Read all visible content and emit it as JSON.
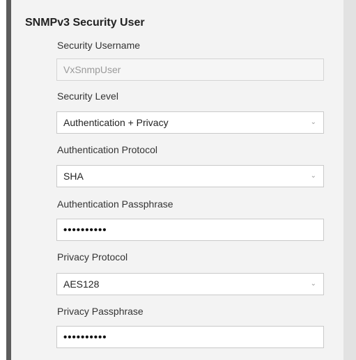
{
  "section": {
    "title": "SNMPv3 Security User"
  },
  "fields": {
    "username": {
      "label": "Security Username",
      "value": "VxSnmpUser"
    },
    "security_level": {
      "label": "Security Level",
      "value": "Authentication + Privacy",
      "icon": "chevron-down-icon"
    },
    "auth_protocol": {
      "label": "Authentication Protocol",
      "value": "SHA",
      "icon": "chevron-down-icon"
    },
    "auth_passphrase": {
      "label": "Authentication Passphrase",
      "value": "••••••••••"
    },
    "privacy_protocol": {
      "label": "Privacy Protocol",
      "value": "AES128",
      "icon": "chevron-down-icon"
    },
    "privacy_passphrase": {
      "label": "Privacy Passphrase",
      "value": "••••••••••"
    }
  },
  "colors": {
    "panel_bg": "#f3f3f3",
    "left_bar": "#5c5c5c",
    "field_border": "#c9c9c9",
    "readonly_text": "#9a9a9a"
  }
}
